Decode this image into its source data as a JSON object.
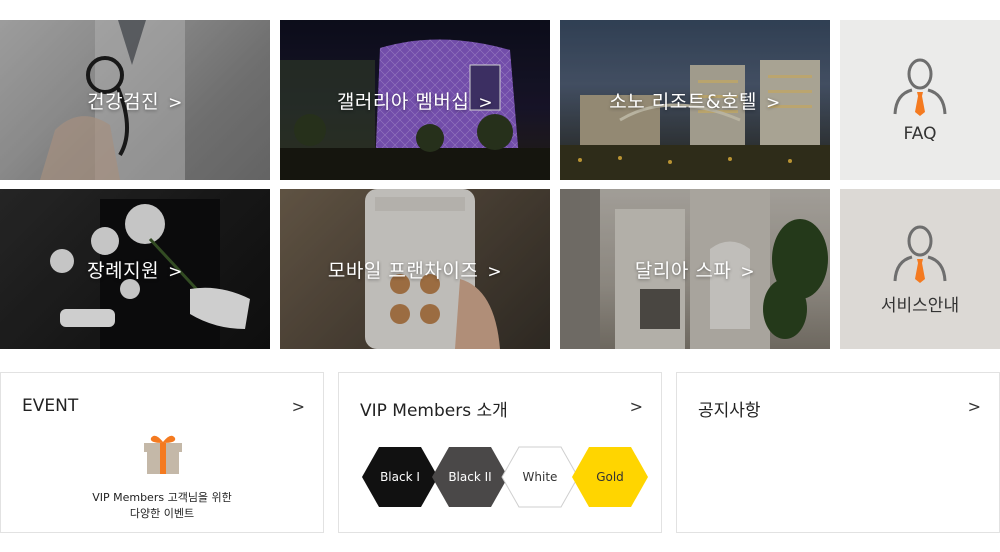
{
  "tiles": [
    {
      "label": "건강검진",
      "arrow": ">",
      "theme": "stethoscope"
    },
    {
      "label": "갤러리아 멤버십",
      "arrow": ">",
      "theme": "building-night"
    },
    {
      "label": "소노 리조트&호텔",
      "arrow": ">",
      "theme": "resort-night"
    },
    {
      "label": "장례지원",
      "arrow": ">",
      "theme": "funeral-flowers"
    },
    {
      "label": "모바일 프랜차이즈",
      "arrow": ">",
      "theme": "mobile-phone"
    },
    {
      "label": "달리아 스파",
      "arrow": ">",
      "theme": "spa-interior"
    }
  ],
  "side": {
    "faq": {
      "label": "FAQ",
      "icon": "person-tie-icon"
    },
    "service": {
      "label": "서비스안내",
      "icon": "person-tie-icon"
    }
  },
  "cards": {
    "event": {
      "title": "EVENT",
      "arrow": ">",
      "text_line1": "VIP Members 고객님을 위한",
      "text_line2": "다양한 이벤트",
      "icon": "gift-icon"
    },
    "members": {
      "title": "VIP Members 소개",
      "arrow": ">",
      "tiers": [
        {
          "label": "Black I",
          "fill": "#111111",
          "text": "#ffffff"
        },
        {
          "label": "Black II",
          "fill": "#4a4848",
          "text": "#ffffff"
        },
        {
          "label": "White",
          "fill": "#ffffff",
          "text": "#333333"
        },
        {
          "label": "Gold",
          "fill": "#ffd500",
          "text": "#333333"
        }
      ]
    },
    "notice": {
      "title": "공지사항",
      "arrow": ">"
    }
  },
  "colors": {
    "accent": "#f47a20",
    "icon_gray": "#6e6e6e",
    "faq_bg": "#ebebea",
    "service_bg": "#dcd9d5"
  }
}
